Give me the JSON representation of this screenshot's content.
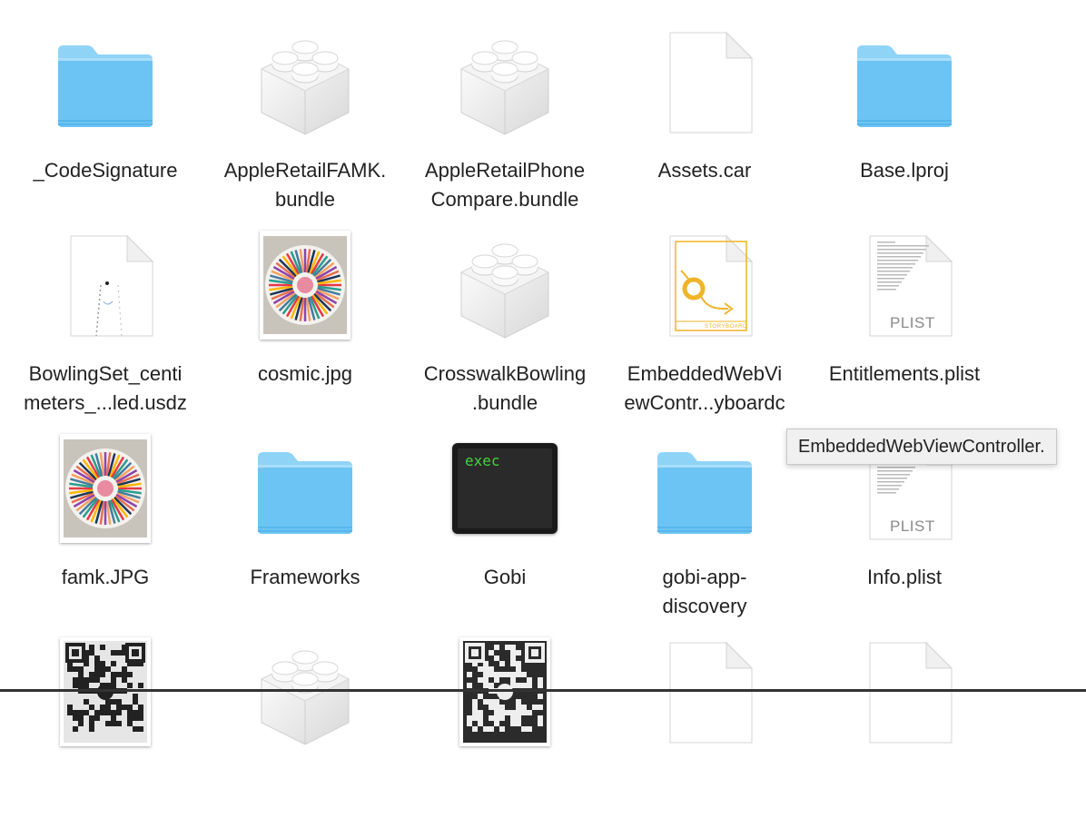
{
  "files": [
    {
      "name": "_CodeSignature",
      "kind": "folder"
    },
    {
      "name": "AppleRetailFAMK.\nbundle",
      "kind": "bundle"
    },
    {
      "name": "AppleRetailPhone\nCompare.bundle",
      "kind": "bundle"
    },
    {
      "name": "Assets.car",
      "kind": "document"
    },
    {
      "name": "Base.lproj",
      "kind": "folder"
    },
    {
      "name": "BowlingSet_centi\nmeters_...led.usdz",
      "kind": "usdz"
    },
    {
      "name": "cosmic.jpg",
      "kind": "image"
    },
    {
      "name": "CrosswalkBowling\n.bundle",
      "kind": "bundle"
    },
    {
      "name": "EmbeddedWebVi\newContr...yboardc",
      "kind": "storyboard"
    },
    {
      "name": "Entitlements.plist",
      "kind": "plist"
    },
    {
      "name": "famk.JPG",
      "kind": "image"
    },
    {
      "name": "Frameworks",
      "kind": "folder"
    },
    {
      "name": "Gobi",
      "kind": "exec"
    },
    {
      "name": "gobi-app-\ndiscovery",
      "kind": "folder"
    },
    {
      "name": "Info.plist",
      "kind": "plist"
    },
    {
      "name": "",
      "kind": "qr"
    },
    {
      "name": "",
      "kind": "bundle"
    },
    {
      "name": "",
      "kind": "qr-dark"
    },
    {
      "name": "",
      "kind": "document"
    },
    {
      "name": "",
      "kind": "document"
    }
  ],
  "plist_tag": "PLIST",
  "storyboard_tag": "STORYBOARD",
  "exec_text": "exec",
  "tooltip": "EmbeddedWebViewController.",
  "colors": {
    "folder": "#6cc4f4",
    "folder_tab": "#8fd3f7",
    "storyboard": "#f0b429",
    "exec_text": "#3fd63f"
  }
}
